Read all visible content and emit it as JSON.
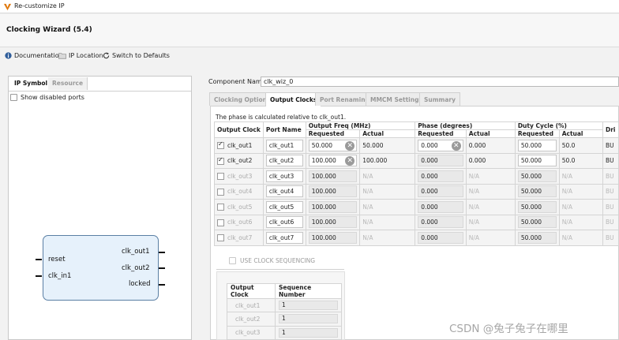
{
  "window": {
    "title": "Re-customize IP"
  },
  "header": {
    "title": "Clocking Wizard (5.4)"
  },
  "toolbar": {
    "documentation": "Documentation",
    "ip_location": "IP Location",
    "switch_defaults": "Switch to Defaults"
  },
  "left_panel": {
    "tabs": [
      "IP Symbol",
      "Resource"
    ],
    "show_disabled_ports": "Show disabled ports",
    "symbol": {
      "inputs": [
        "reset",
        "clk_in1"
      ],
      "outputs": [
        "clk_out1",
        "clk_out2",
        "locked"
      ]
    }
  },
  "component": {
    "label": "Component Name",
    "value": "clk_wiz_0"
  },
  "tabs": [
    "Clocking Options",
    "Output Clocks",
    "Port Renaming",
    "MMCM Settings",
    "Summary"
  ],
  "phase_note": "The phase is calculated relative to clk_out1.",
  "table": {
    "headers": {
      "output_clock": "Output Clock",
      "port_name": "Port Name",
      "freq": "Output Freq (MHz)",
      "phase": "Phase (degrees)",
      "duty": "Duty Cycle (%)",
      "drives": "Dri",
      "requested": "Requested",
      "actual": "Actual"
    },
    "rows": [
      {
        "clock": "clk_out1",
        "checked": true,
        "port": "clk_out1",
        "freq_req": "50.000",
        "freq_act": "50.000",
        "phase_req": "0.000",
        "phase_act": "0.000",
        "duty_req": "50.000",
        "duty_act": "50.0",
        "drives": "BU",
        "enabled": true
      },
      {
        "clock": "clk_out2",
        "checked": true,
        "port": "clk_out2",
        "freq_req": "100.000",
        "freq_act": "100.000",
        "phase_req": "0.000",
        "phase_act": "0.000",
        "duty_req": "50.000",
        "duty_act": "50.0",
        "drives": "BU",
        "enabled": true
      },
      {
        "clock": "clk_out3",
        "checked": false,
        "port": "clk_out3",
        "freq_req": "100.000",
        "freq_act": "N/A",
        "phase_req": "0.000",
        "phase_act": "N/A",
        "duty_req": "50.000",
        "duty_act": "N/A",
        "drives": "BU",
        "enabled": false
      },
      {
        "clock": "clk_out4",
        "checked": false,
        "port": "clk_out4",
        "freq_req": "100.000",
        "freq_act": "N/A",
        "phase_req": "0.000",
        "phase_act": "N/A",
        "duty_req": "50.000",
        "duty_act": "N/A",
        "drives": "BU",
        "enabled": false
      },
      {
        "clock": "clk_out5",
        "checked": false,
        "port": "clk_out5",
        "freq_req": "100.000",
        "freq_act": "N/A",
        "phase_req": "0.000",
        "phase_act": "N/A",
        "duty_req": "50.000",
        "duty_act": "N/A",
        "drives": "BU",
        "enabled": false
      },
      {
        "clock": "clk_out6",
        "checked": false,
        "port": "clk_out6",
        "freq_req": "100.000",
        "freq_act": "N/A",
        "phase_req": "0.000",
        "phase_act": "N/A",
        "duty_req": "50.000",
        "duty_act": "N/A",
        "drives": "BU",
        "enabled": false
      },
      {
        "clock": "clk_out7",
        "checked": false,
        "port": "clk_out7",
        "freq_req": "100.000",
        "freq_act": "N/A",
        "phase_req": "0.000",
        "phase_act": "N/A",
        "duty_req": "50.000",
        "duty_act": "N/A",
        "drives": "BU",
        "enabled": false
      }
    ]
  },
  "sequencing": {
    "label": "USE CLOCK SEQUENCING",
    "headers": [
      "Output Clock",
      "Sequence Number"
    ],
    "rows": [
      {
        "clock": "clk_out1",
        "seq": "1"
      },
      {
        "clock": "clk_out2",
        "seq": "1"
      },
      {
        "clock": "clk_out3",
        "seq": "1"
      }
    ]
  },
  "watermark": "CSDN @兔子兔子在哪里",
  "colors": {
    "symbol_fill": "#e6f1fb",
    "symbol_border": "#5a7fa4"
  }
}
